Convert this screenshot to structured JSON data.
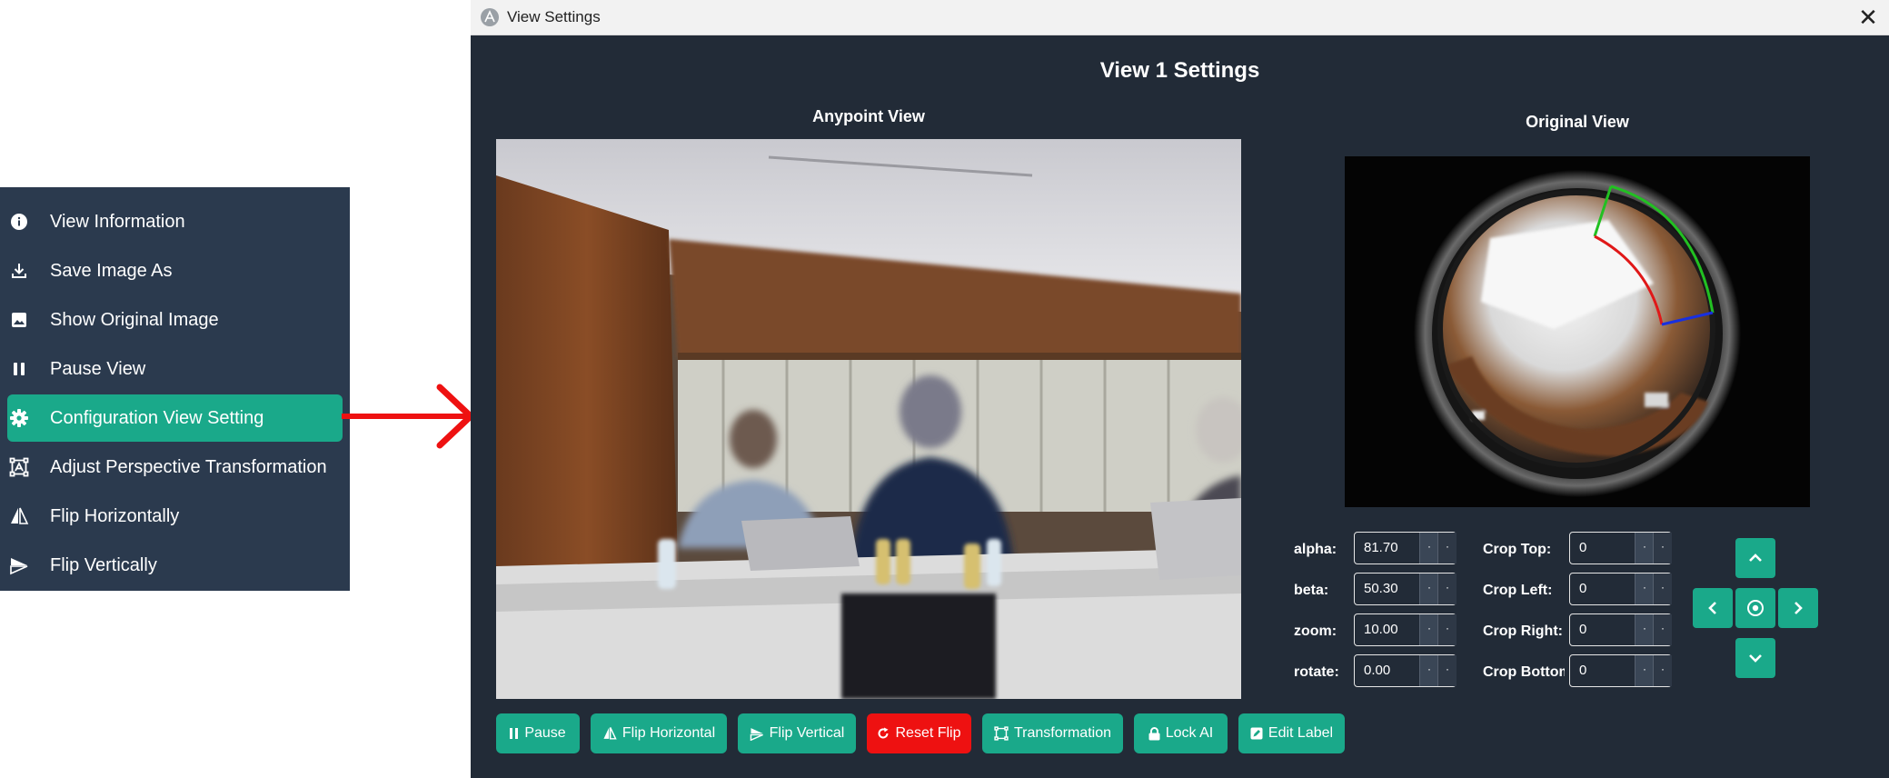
{
  "context_menu": {
    "items": [
      {
        "label": "View Information",
        "icon": "info-icon"
      },
      {
        "label": "Save Image As",
        "icon": "download-icon"
      },
      {
        "label": "Show Original Image",
        "icon": "image-icon"
      },
      {
        "label": "Pause View",
        "icon": "pause-icon"
      },
      {
        "label": "Configuration View Setting",
        "icon": "gear-icon",
        "active": true
      },
      {
        "label": "Adjust Perspective Transformation",
        "icon": "transform-icon"
      },
      {
        "label": "Flip Horizontally",
        "icon": "flip-horizontal-icon"
      },
      {
        "label": "Flip Vertically",
        "icon": "flip-vertical-icon"
      }
    ],
    "active_color": "#1aa98a",
    "background": "#2b3a4e"
  },
  "annotation": {
    "arrow_color": "#ee1111"
  },
  "window": {
    "title": "View Settings",
    "close_glyph": "✕",
    "heading": "View 1 Settings",
    "anypoint_title": "Anypoint View",
    "original_title": "Original View",
    "background": "#222b37"
  },
  "params": {
    "alpha": {
      "label": "alpha:",
      "value": "81.70"
    },
    "beta": {
      "label": "beta:",
      "value": "50.30"
    },
    "zoom": {
      "label": "zoom:",
      "value": "10.00"
    },
    "rotate": {
      "label": "rotate:",
      "value": "0.00"
    },
    "crop_top": {
      "label": "Crop Top:",
      "value": "0"
    },
    "crop_left": {
      "label": "Crop Left:",
      "value": "0"
    },
    "crop_right": {
      "label": "Crop Right:",
      "value": "0"
    },
    "crop_bottom": {
      "label": "Crop Bottom:",
      "value": "0"
    },
    "spin_glyph": "·"
  },
  "buttons": {
    "pause": "Pause",
    "flip_horizontal": "Flip Horizontal",
    "flip_vertical": "Flip Vertical",
    "reset_flip": "Reset Flip",
    "transformation": "Transformation",
    "lock_ai": "Lock AI",
    "edit_label": "Edit Label"
  },
  "colors": {
    "accent": "#1aa98a",
    "danger": "#ee1111"
  }
}
